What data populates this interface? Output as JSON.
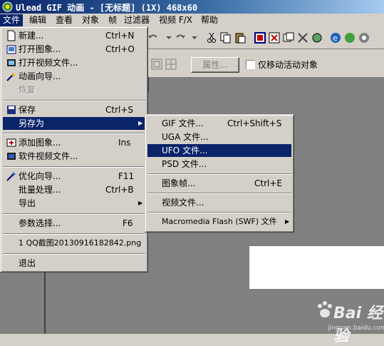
{
  "window": {
    "title": "Ulead GIF 动画 - [无标题] (1X) 468x60"
  },
  "menubar": [
    "文件",
    "编辑",
    "查看",
    "对象",
    "帧",
    "过滤器",
    "视频 F/X",
    "帮助"
  ],
  "toolbar": {
    "properties_label": "属性...",
    "checkbox_label": "仅移动活动对象"
  },
  "file_menu": {
    "items": [
      {
        "label": "新建...",
        "shortcut": "Ctrl+N"
      },
      {
        "label": "打开图象...",
        "shortcut": "Ctrl+O"
      },
      {
        "label": "打开视频文件...",
        "shortcut": ""
      },
      {
        "label": "动画向导...",
        "shortcut": ""
      },
      {
        "label": "恢复",
        "shortcut": ""
      },
      {
        "label": "保存",
        "shortcut": "Ctrl+S"
      },
      {
        "label": "另存为",
        "shortcut": ""
      },
      {
        "label": "添加图象...",
        "shortcut": "Ins"
      },
      {
        "label": "软件视频文件...",
        "shortcut": ""
      },
      {
        "label": "优化向导...",
        "shortcut": "F11"
      },
      {
        "label": "批量处理...",
        "shortcut": "Ctrl+B"
      },
      {
        "label": "导出",
        "shortcut": ""
      },
      {
        "label": "参数选择...",
        "shortcut": "F6"
      },
      {
        "label": "1 QQ截图20130916182842.png",
        "shortcut": ""
      },
      {
        "label": "退出",
        "shortcut": ""
      }
    ]
  },
  "save_as_menu": {
    "items": [
      {
        "label": "GIF 文件...",
        "shortcut": "Ctrl+Shift+S"
      },
      {
        "label": "UGA 文件...",
        "shortcut": ""
      },
      {
        "label": "UFO 文件...",
        "shortcut": ""
      },
      {
        "label": "PSD 文件...",
        "shortcut": ""
      },
      {
        "label": "图象帧...",
        "shortcut": "Ctrl+E"
      },
      {
        "label": "视频文件...",
        "shortcut": ""
      },
      {
        "label": "Macromedia Flash (SWF) 文件",
        "shortcut": ""
      }
    ]
  },
  "watermark": {
    "text": "Bai 经验",
    "sub": "jingyan.baidu.com"
  }
}
